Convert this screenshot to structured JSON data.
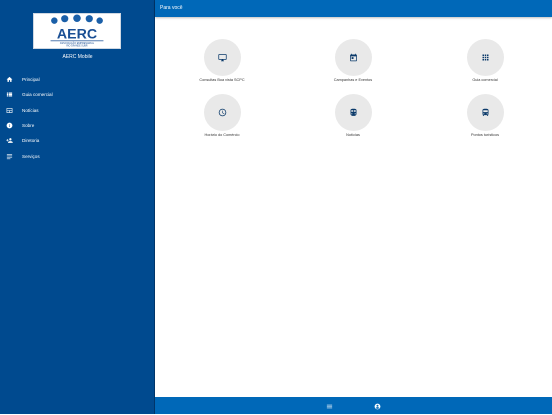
{
  "sidebar": {
    "logo": {
      "name": "AERC",
      "tagline": "ASSOCIAÇÃO EMPRESARIAL",
      "tagline2": "RIO GRANDE SUBR"
    },
    "app_name": "AERC Mobile",
    "items": [
      {
        "label": "Principal",
        "icon": "home-icon"
      },
      {
        "label": "Guia comercial",
        "icon": "list-icon"
      },
      {
        "label": "Notícias",
        "icon": "newspaper-icon"
      },
      {
        "label": "Sobre",
        "icon": "info-icon"
      },
      {
        "label": "Diretoria",
        "icon": "person-add-icon"
      },
      {
        "label": "Serviços",
        "icon": "notes-icon"
      }
    ]
  },
  "header": {
    "title": "Para você"
  },
  "tiles": [
    {
      "label": "Consultas Boa vista SCPC",
      "icon": "monitor-icon"
    },
    {
      "label": "Campanhas e Eventos",
      "icon": "calendar-icon"
    },
    {
      "label": "Guia comercial",
      "icon": "grid-icon"
    },
    {
      "label": "Horário do Comércio",
      "icon": "clock-icon"
    },
    {
      "label": "Notícias",
      "icon": "train-icon"
    },
    {
      "label": "Pontos turísticos",
      "icon": "bus-icon"
    }
  ],
  "bottom_bar": {
    "left_icon": "menu-icon",
    "right_icon": "account-icon"
  },
  "colors": {
    "sidebar": "#004a8f",
    "topbar": "#0068b8",
    "tile_circle": "#e9e9e9",
    "icon": "#0b3a6a"
  }
}
